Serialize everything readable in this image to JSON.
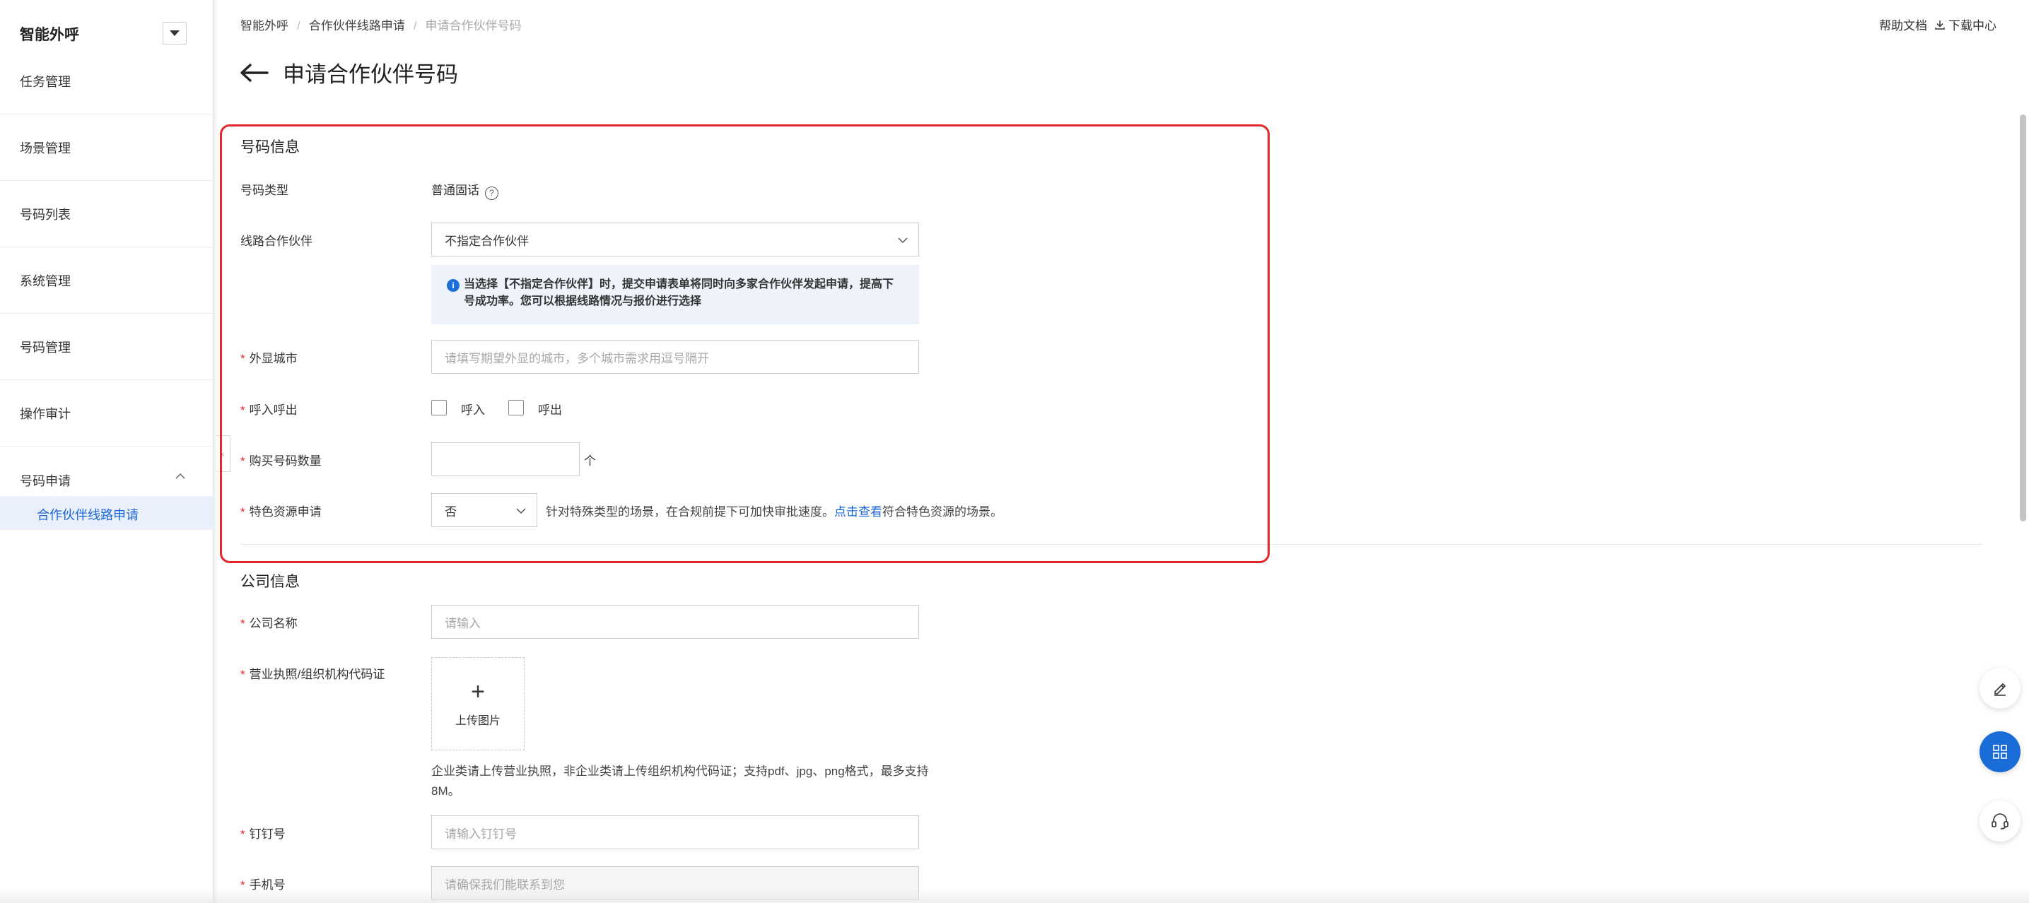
{
  "sidebar": {
    "app_title": "智能外呼",
    "items": [
      {
        "label": "任务管理"
      },
      {
        "label": "场景管理"
      },
      {
        "label": "号码列表"
      },
      {
        "label": "系统管理"
      },
      {
        "label": "号码管理"
      },
      {
        "label": "操作审计"
      }
    ],
    "group": {
      "label": "号码申请",
      "expanded": true,
      "sub_items": [
        {
          "label": "合作伙伴线路申请",
          "active": true
        }
      ]
    }
  },
  "header": {
    "breadcrumb": [
      "智能外呼",
      "合作伙伴线路申请",
      "申请合作伙伴号码"
    ],
    "help_doc": "帮助文档",
    "download_center": "下载中心",
    "page_title": "申请合作伙伴号码"
  },
  "number_info": {
    "section_title": "号码信息",
    "number_type_label": "号码类型",
    "number_type_value": "普通固话",
    "partner_label": "线路合作伙伴",
    "partner_value": "不指定合作伙伴",
    "notice": "当选择【不指定合作伙伴】时，提交申请表单将同时向多家合作伙伴发起申请，提高下号成功率。您可以根据线路情况与报价进行选择",
    "city_label": "外显城市",
    "city_placeholder": "请填写期望外显的城市，多个城市需求用逗号隔开",
    "direction_label": "呼入呼出",
    "direction_in": "呼入",
    "direction_out": "呼出",
    "quantity_label": "购买号码数量",
    "quantity_unit": "个",
    "special_label": "特色资源申请",
    "special_value": "否",
    "special_hint_before": "针对特殊类型的场景，在合规前提下可加快审批速度。",
    "special_hint_link": "点击查看",
    "special_hint_after": "符合特色资源的场景。"
  },
  "company_info": {
    "section_title": "公司信息",
    "name_label": "公司名称",
    "name_placeholder": "请输入",
    "license_label": "营业执照/组织机构代码证",
    "upload_label": "上传图片",
    "upload_hint": "企业类请上传营业执照，非企业类请上传组织机构代码证；支持pdf、jpg、png格式，最多支持8M。",
    "dingtalk_label": "钉钉号",
    "dingtalk_placeholder": "请输入钉钉号",
    "phone_label": "手机号",
    "phone_placeholder": "请确保我们能联系到您"
  },
  "colors": {
    "accent": "#1a66d6",
    "required": "#e0262c",
    "highlight_border": "#e3262c",
    "notice_bg": "#eef3fb"
  },
  "icons": [
    "chevron-down-icon",
    "chevron-up-icon",
    "back-arrow-icon",
    "download-icon",
    "help-icon",
    "info-icon",
    "plus-icon",
    "edit-icon",
    "grid-icon",
    "headset-icon",
    "collapse-icon"
  ]
}
